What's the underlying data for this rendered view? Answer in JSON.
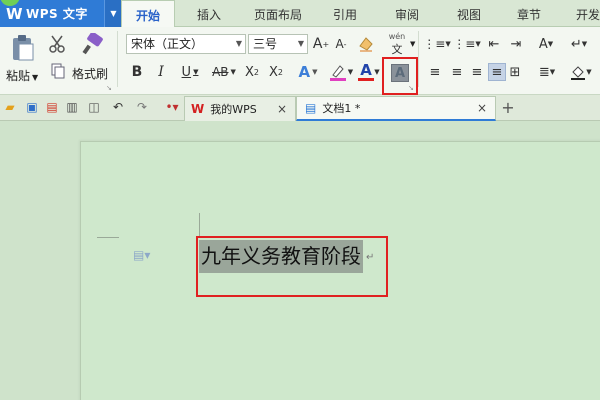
{
  "app": {
    "title": "WPS 文字",
    "logo": "W"
  },
  "ribbon_tabs": [
    "开始",
    "插入",
    "页面布局",
    "引用",
    "审阅",
    "视图",
    "章节",
    "开发"
  ],
  "active_tab": "开始",
  "clipboard": {
    "paste_label": "粘贴",
    "format_painter_label": "格式刷"
  },
  "font": {
    "name": "宋体（正文）",
    "size": "三号"
  },
  "phonetic": {
    "label": "wén"
  },
  "doc_tabs": [
    {
      "label": "我的WPS"
    },
    {
      "label": "文档1 *"
    }
  ],
  "document": {
    "text": "九年义务教育阶段"
  },
  "colors": {
    "accent": "#2f7bd6",
    "highlight_border": "#e02020",
    "font_color_bar": "#e02020",
    "highlight_bar": "#e040c0"
  }
}
